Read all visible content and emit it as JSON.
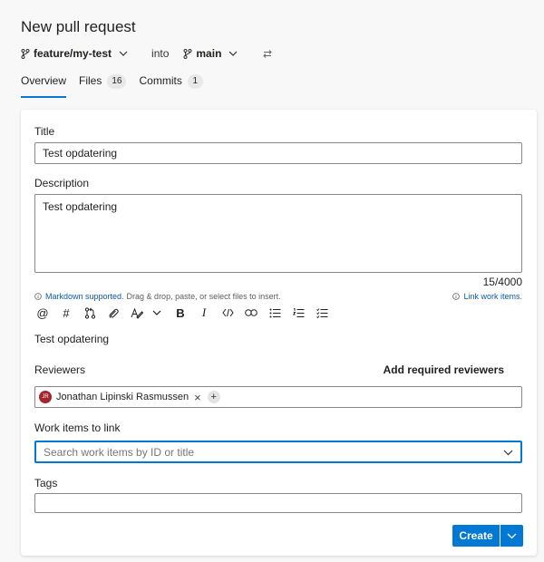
{
  "page": {
    "title": "New pull request"
  },
  "branches": {
    "source": "feature/my-test",
    "into_label": "into",
    "target": "main"
  },
  "tabs": [
    {
      "label": "Overview",
      "active": true
    },
    {
      "label": "Files",
      "count": "16"
    },
    {
      "label": "Commits",
      "count": "1"
    }
  ],
  "form": {
    "title_label": "Title",
    "title_value": "Test opdatering",
    "description_label": "Description",
    "description_value": "Test opdatering",
    "char_count": "15/4000",
    "markdown_link": "Markdown supported.",
    "markdown_hint": "Drag & drop, paste, or select files to insert.",
    "link_work_items": "Link work items.",
    "preview_text": "Test opdatering",
    "reviewers_label": "Reviewers",
    "add_required_reviewers": "Add required reviewers",
    "reviewer": {
      "initials": "JR",
      "name": "Jonathan Lipinski Rasmussen"
    },
    "work_items_label": "Work items to link",
    "work_items_placeholder": "Search work items by ID or title",
    "tags_label": "Tags",
    "create_button": "Create"
  },
  "icons": {
    "toolbar": [
      "mention-icon",
      "hashtag-icon",
      "pull-request-icon",
      "attach-icon",
      "highlight-icon",
      "chevron-down-icon",
      "bold-icon",
      "italic-icon",
      "code-icon",
      "link-icon",
      "bulleted-list-icon",
      "numbered-list-icon",
      "checklist-icon"
    ]
  },
  "colors": {
    "accent": "#0078d4",
    "link": "#0b5cad",
    "avatar": "#a4262c"
  }
}
